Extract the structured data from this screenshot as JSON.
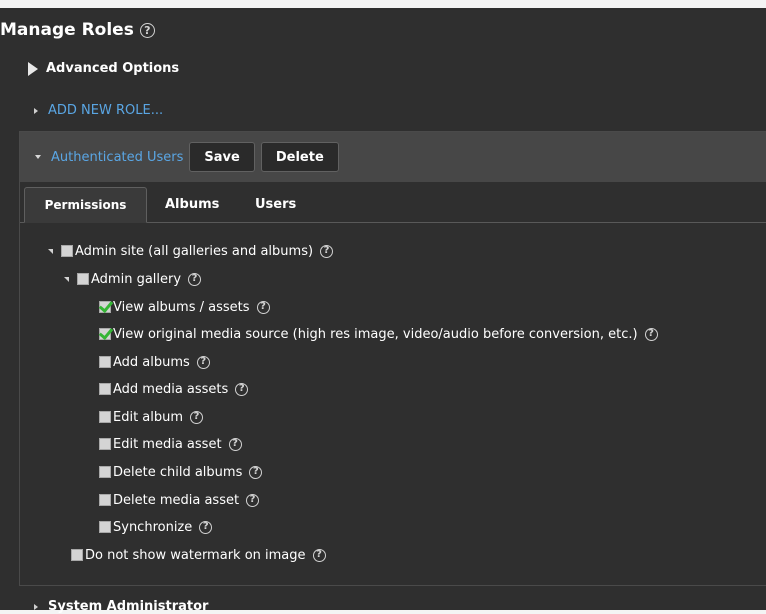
{
  "page": {
    "title": "Manage Roles",
    "help": "?"
  },
  "advanced": {
    "label": "Advanced Options"
  },
  "add_role": {
    "label": "ADD NEW ROLE..."
  },
  "role": {
    "name": "Authenticated Users",
    "save_label": "Save",
    "delete_label": "Delete"
  },
  "tabs": [
    {
      "label": "Permissions",
      "active": true
    },
    {
      "label": "Albums",
      "active": false
    },
    {
      "label": "Users",
      "active": false
    }
  ],
  "permissions": [
    {
      "label": "Admin site (all galleries and albums)",
      "checked": false,
      "level": 0,
      "expanded": true
    },
    {
      "label": "Admin gallery",
      "checked": false,
      "level": 1,
      "expanded": true
    },
    {
      "label": "View albums / assets",
      "checked": true,
      "level": 2
    },
    {
      "label": "View original media source (high res image, video/audio before conversion, etc.)",
      "checked": true,
      "level": 2
    },
    {
      "label": "Add albums",
      "checked": false,
      "level": 2
    },
    {
      "label": "Add media assets",
      "checked": false,
      "level": 2
    },
    {
      "label": "Edit album",
      "checked": false,
      "level": 2
    },
    {
      "label": "Edit media asset",
      "checked": false,
      "level": 2
    },
    {
      "label": "Delete child albums",
      "checked": false,
      "level": 2
    },
    {
      "label": "Delete media asset",
      "checked": false,
      "level": 2
    },
    {
      "label": "Synchronize",
      "checked": false,
      "level": 2
    },
    {
      "label": "Do not show watermark on image",
      "checked": false,
      "level": 1
    }
  ],
  "other_roles": [
    {
      "label": "System Administrator"
    }
  ],
  "colors": {
    "background": "#2f2f2f",
    "link": "#5aa6e4",
    "check": "#35b535"
  }
}
